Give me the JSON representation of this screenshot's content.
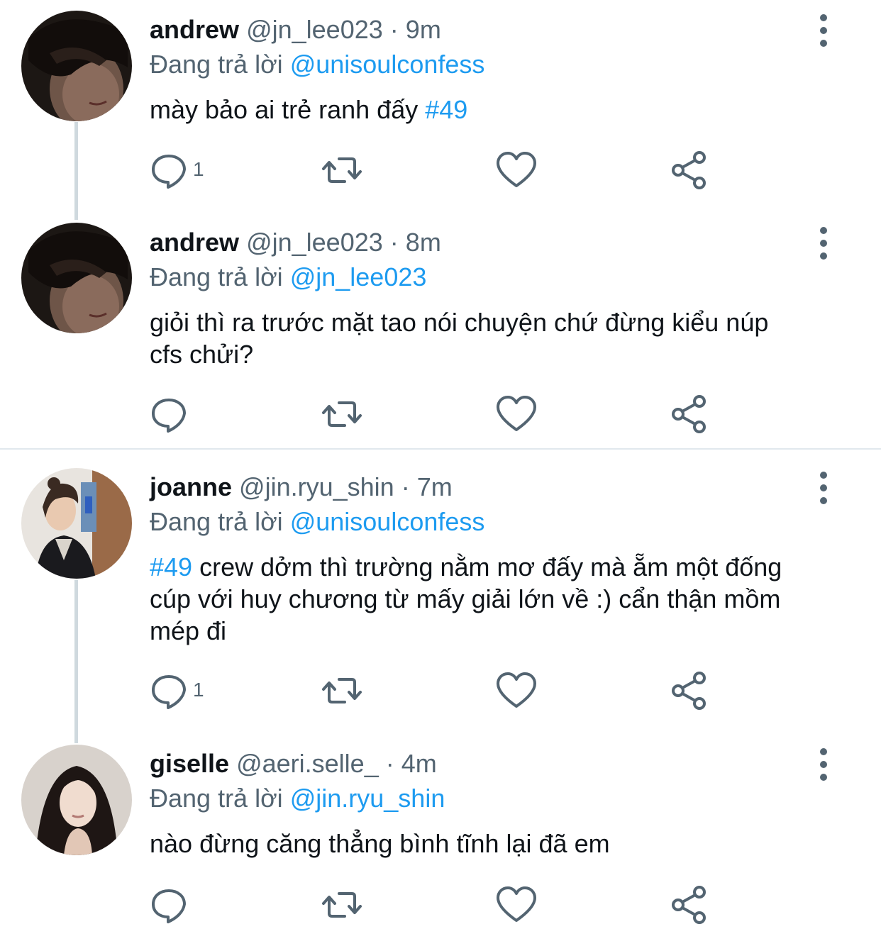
{
  "tweets": [
    {
      "name": "andrew",
      "handle": "@jn_lee023",
      "sep": "·",
      "time": "9m",
      "replying_prefix": "Đang trả lời",
      "replying_to": "@unisoulconfess",
      "text_before": "mày bảo ai trẻ ranh đấy ",
      "hashtag": "#49",
      "text_after": "",
      "reply_count": "1"
    },
    {
      "name": "andrew",
      "handle": "@jn_lee023",
      "sep": "·",
      "time": "8m",
      "replying_prefix": "Đang trả lời",
      "replying_to": "@jn_lee023",
      "text_before": "giỏi thì ra trước mặt tao nói chuyện chứ đừng kiểu núp cfs chửi?",
      "hashtag": "",
      "text_after": "",
      "reply_count": ""
    },
    {
      "name": "joanne",
      "handle": "@jin.ryu_shin",
      "sep": "·",
      "time": "7m",
      "replying_prefix": "Đang trả lời",
      "replying_to": "@unisoulconfess",
      "text_before": "",
      "hashtag": "#49",
      "text_after": " crew dởm thì trường nằm mơ đấy mà ẵm một đống cúp với huy chương từ mấy giải lớn về :) cẩn thận mồm mép đi",
      "reply_count": "1"
    },
    {
      "name": "giselle",
      "handle": "@aeri.selle_",
      "sep": "·",
      "time": "4m",
      "replying_prefix": "Đang trả lời",
      "replying_to": "@jin.ryu_shin",
      "text_before": "nào đừng căng thẳng bình tĩnh lại đã em",
      "hashtag": "",
      "text_after": "",
      "reply_count": ""
    }
  ],
  "icons": {
    "reply": "reply-icon",
    "retweet": "retweet-icon",
    "like": "heart-icon",
    "share": "share-icon",
    "more": "more-options-icon"
  },
  "colors": {
    "link": "#1d9bf0",
    "secondary": "#536471",
    "thread_line": "#cfd9de"
  }
}
